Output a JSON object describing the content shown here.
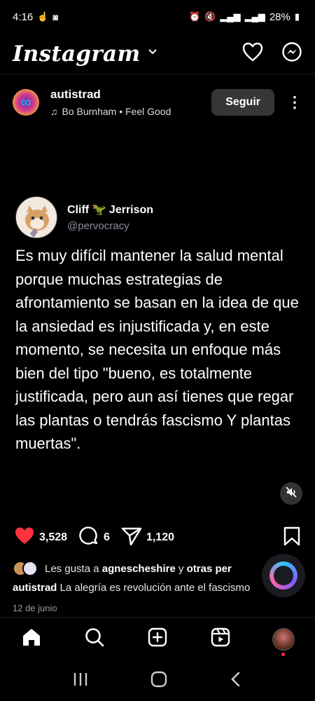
{
  "status_bar": {
    "time": "4:16",
    "battery": "28%"
  },
  "header": {
    "logo": "Instagram"
  },
  "post": {
    "username": "autistrad",
    "audio": "Bo Burnham • Feel Good",
    "follow_label": "Seguir"
  },
  "tweet": {
    "name": "Cliff 🦖 Jerrison",
    "handle": "@pervocracy",
    "text": "Es muy difícil mantener la salud mental porque muchas estrategias de afrontamiento se basan en la idea de que la ansiedad es injustificada y, en este momento, se necesita un enfoque más bien del tipo \"bueno, es totalmente justificada, pero aun así tienes que regar las plantas o tendrás fascismo Y plantas muertas\"."
  },
  "actions": {
    "likes": "3,528",
    "comments": "6",
    "shares": "1,120"
  },
  "likes_line": {
    "prefix": "Les gusta a",
    "user": "agnescheshire",
    "joiner": "y",
    "others": "otras per"
  },
  "caption": {
    "user": "autistrad",
    "text": "La alegría es revolución ante el fascismo"
  },
  "date": "12 de junio",
  "colors": {
    "like": "#ff3040",
    "follow_bg": "#363636"
  }
}
